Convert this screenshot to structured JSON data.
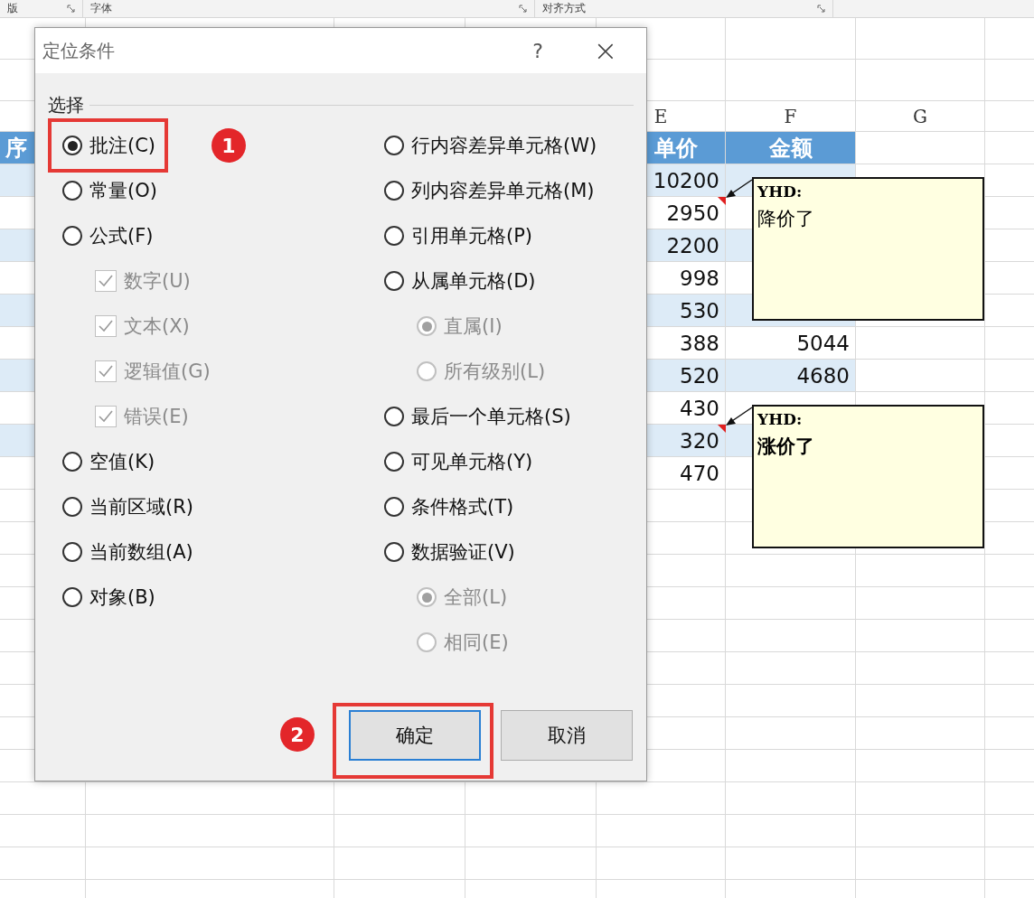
{
  "ribbon": {
    "groups": [
      {
        "label": "版"
      },
      {
        "label": "字体"
      },
      {
        "label": "对齐方式"
      }
    ]
  },
  "sheet": {
    "column_headers": [
      "E",
      "F",
      "G"
    ],
    "header": {
      "column_1": "序",
      "price": "单价",
      "amount": "金额"
    },
    "rows": [
      {
        "price": "10200"
      },
      {
        "price": "2950",
        "comment": {
          "author": "YHD:",
          "text": "降价了",
          "bold": false
        }
      },
      {
        "price": "2200"
      },
      {
        "price": "998"
      },
      {
        "price": "530"
      },
      {
        "price": "388",
        "amount": "5044"
      },
      {
        "price": "520",
        "amount": "4680"
      },
      {
        "price": "430"
      },
      {
        "price": "320",
        "comment": {
          "author": "YHD:",
          "text": "涨价了",
          "bold": true
        }
      },
      {
        "price": "470"
      }
    ]
  },
  "dialog": {
    "title": "定位条件",
    "help": "?",
    "close": "×",
    "section": "选择",
    "left": [
      {
        "kind": "radio",
        "label": "批注(C)",
        "selected": true,
        "disabled": false,
        "callout": "1"
      },
      {
        "kind": "radio",
        "label": "常量(O)",
        "selected": false,
        "disabled": false
      },
      {
        "kind": "radio",
        "label": "公式(F)",
        "selected": false,
        "disabled": false,
        "children": [
          {
            "kind": "checkbox",
            "label": "数字(U)",
            "checked": true,
            "disabled": true
          },
          {
            "kind": "checkbox",
            "label": "文本(X)",
            "checked": true,
            "disabled": true
          },
          {
            "kind": "checkbox",
            "label": "逻辑值(G)",
            "checked": true,
            "disabled": true
          },
          {
            "kind": "checkbox",
            "label": "错误(E)",
            "checked": true,
            "disabled": true
          }
        ]
      },
      {
        "kind": "radio",
        "label": "空值(K)",
        "selected": false,
        "disabled": false
      },
      {
        "kind": "radio",
        "label": "当前区域(R)",
        "selected": false,
        "disabled": false
      },
      {
        "kind": "radio",
        "label": "当前数组(A)",
        "selected": false,
        "disabled": false
      },
      {
        "kind": "radio",
        "label": "对象(B)",
        "selected": false,
        "disabled": false
      }
    ],
    "right": [
      {
        "kind": "radio",
        "label": "行内容差异单元格(W)",
        "selected": false,
        "disabled": false
      },
      {
        "kind": "radio",
        "label": "列内容差异单元格(M)",
        "selected": false,
        "disabled": false
      },
      {
        "kind": "radio",
        "label": "引用单元格(P)",
        "selected": false,
        "disabled": false
      },
      {
        "kind": "radio",
        "label": "从属单元格(D)",
        "selected": false,
        "disabled": false,
        "children": [
          {
            "kind": "radio",
            "label": "直属(I)",
            "selected": true,
            "disabled": true
          },
          {
            "kind": "radio",
            "label": "所有级别(L)",
            "selected": false,
            "disabled": true
          }
        ]
      },
      {
        "kind": "radio",
        "label": "最后一个单元格(S)",
        "selected": false,
        "disabled": false
      },
      {
        "kind": "radio",
        "label": "可见单元格(Y)",
        "selected": false,
        "disabled": false
      },
      {
        "kind": "radio",
        "label": "条件格式(T)",
        "selected": false,
        "disabled": false
      },
      {
        "kind": "radio",
        "label": "数据验证(V)",
        "selected": false,
        "disabled": false,
        "children": [
          {
            "kind": "radio",
            "label": "全部(L)",
            "selected": true,
            "disabled": true
          },
          {
            "kind": "radio",
            "label": "相同(E)",
            "selected": false,
            "disabled": true
          }
        ]
      }
    ],
    "buttons": [
      {
        "label": "确定",
        "default": true,
        "callout": "2"
      },
      {
        "label": "取消",
        "default": false
      }
    ]
  }
}
